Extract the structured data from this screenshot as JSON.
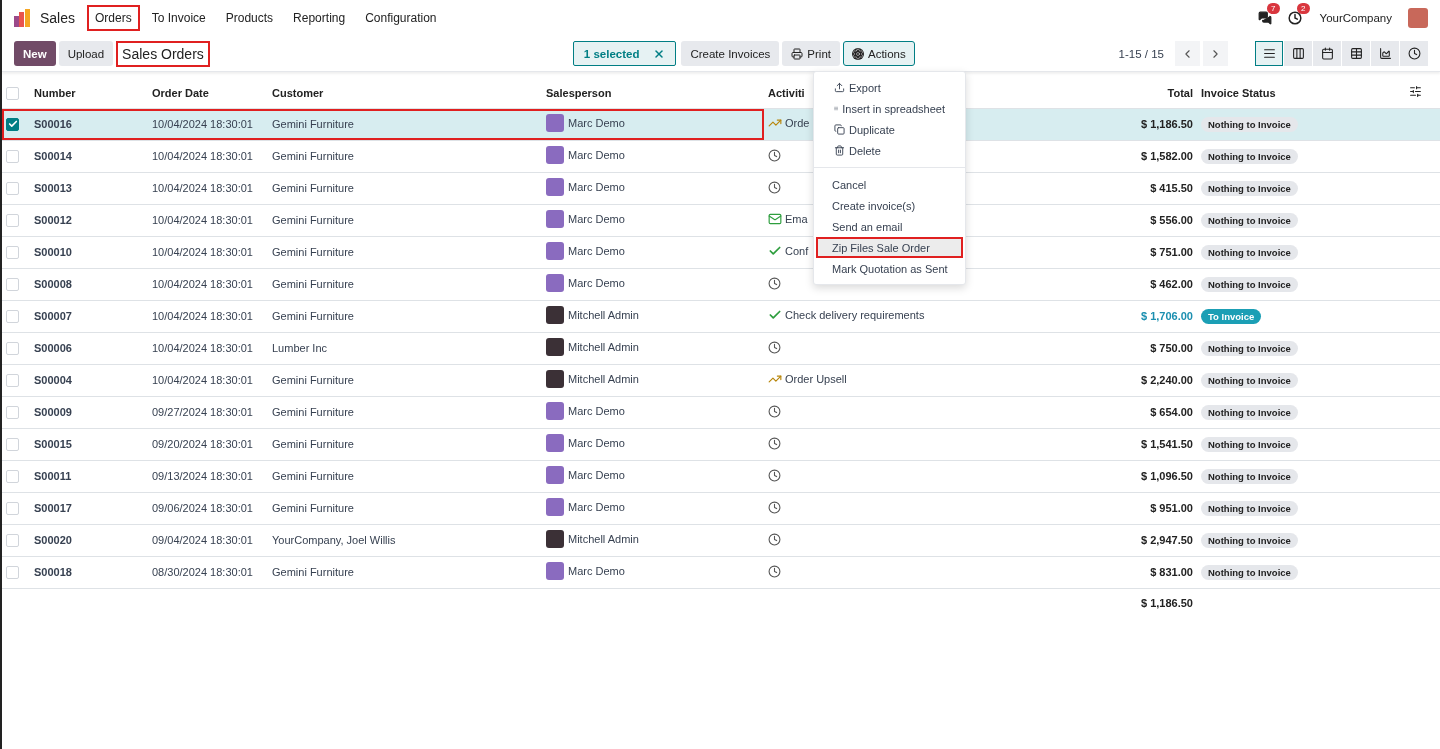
{
  "app": {
    "name": "Sales"
  },
  "menu": [
    {
      "label": "Orders",
      "highlighted": true
    },
    {
      "label": "To Invoice",
      "highlighted": false
    },
    {
      "label": "Products",
      "highlighted": false
    },
    {
      "label": "Reporting",
      "highlighted": false
    },
    {
      "label": "Configuration",
      "highlighted": false
    }
  ],
  "notifications": [
    {
      "kind": "messages",
      "count": "7"
    },
    {
      "kind": "activities",
      "count": "2"
    }
  ],
  "company": "YourCompany",
  "toolbar": {
    "buttons": [
      {
        "label": "New",
        "kind": "primary"
      },
      {
        "label": "Upload",
        "kind": "secondary"
      }
    ],
    "title": "Sales Orders",
    "title_highlighted": true,
    "selection": "1 selected",
    "actions": [
      {
        "label": "Create Invoices",
        "kind": "plain",
        "open": false
      },
      {
        "label": "Print",
        "kind": "print",
        "open": false
      },
      {
        "label": "Actions",
        "kind": "gear",
        "open": true
      }
    ],
    "pager": "1-15 / 15",
    "views": [
      {
        "kind": "list",
        "selected": true
      },
      {
        "kind": "kanban",
        "selected": false
      },
      {
        "kind": "calendar",
        "selected": false
      },
      {
        "kind": "pivot",
        "selected": false
      },
      {
        "kind": "graph",
        "selected": false
      },
      {
        "kind": "activity",
        "selected": false
      }
    ]
  },
  "table": {
    "all_selected": false,
    "columns": [
      "Number",
      "Order Date",
      "Customer",
      "Salesperson",
      "Activiti",
      "Total",
      "Invoice Status"
    ],
    "rows": [
      {
        "number": "S00016",
        "date": "10/04/2024 18:30:01",
        "customer": "Gemini Furniture",
        "salesperson": {
          "name": "Marc Demo",
          "color": "#8a6bbf"
        },
        "activity": {
          "kind": "upsell",
          "text": "Orde"
        },
        "total": "$ 1,186.50",
        "status": {
          "label": "Nothing to Invoice",
          "kind": "nothing"
        },
        "selected": true,
        "highlighted": true
      },
      {
        "number": "S00014",
        "date": "10/04/2024 18:30:01",
        "customer": "Gemini Furniture",
        "salesperson": {
          "name": "Marc Demo",
          "color": "#8a6bbf"
        },
        "activity": {
          "kind": "none"
        },
        "total": "$ 1,582.00",
        "status": {
          "label": "Nothing to Invoice",
          "kind": "nothing"
        },
        "selected": false,
        "highlighted": false
      },
      {
        "number": "S00013",
        "date": "10/04/2024 18:30:01",
        "customer": "Gemini Furniture",
        "salesperson": {
          "name": "Marc Demo",
          "color": "#8a6bbf"
        },
        "activity": {
          "kind": "none"
        },
        "total": "$ 415.50",
        "status": {
          "label": "Nothing to Invoice",
          "kind": "nothing"
        },
        "selected": false,
        "highlighted": false
      },
      {
        "number": "S00012",
        "date": "10/04/2024 18:30:01",
        "customer": "Gemini Furniture",
        "salesperson": {
          "name": "Marc Demo",
          "color": "#8a6bbf"
        },
        "activity": {
          "kind": "email",
          "text": "Ema"
        },
        "total": "$ 556.00",
        "status": {
          "label": "Nothing to Invoice",
          "kind": "nothing"
        },
        "selected": false,
        "highlighted": false
      },
      {
        "number": "S00010",
        "date": "10/04/2024 18:30:01",
        "customer": "Gemini Furniture",
        "salesperson": {
          "name": "Marc Demo",
          "color": "#8a6bbf"
        },
        "activity": {
          "kind": "todo",
          "text": "Conf"
        },
        "total": "$ 751.00",
        "status": {
          "label": "Nothing to Invoice",
          "kind": "nothing"
        },
        "selected": false,
        "highlighted": false
      },
      {
        "number": "S00008",
        "date": "10/04/2024 18:30:01",
        "customer": "Gemini Furniture",
        "salesperson": {
          "name": "Marc Demo",
          "color": "#8a6bbf"
        },
        "activity": {
          "kind": "none"
        },
        "total": "$ 462.00",
        "status": {
          "label": "Nothing to Invoice",
          "kind": "nothing"
        },
        "selected": false,
        "highlighted": false
      },
      {
        "number": "S00007",
        "date": "10/04/2024 18:30:01",
        "customer": "Gemini Furniture",
        "salesperson": {
          "name": "Mitchell Admin",
          "color": "#3b3036"
        },
        "activity": {
          "kind": "todo",
          "text": "Check delivery requirements"
        },
        "total": "$ 1,706.00",
        "status": {
          "label": "To Invoice",
          "kind": "to_invoice"
        },
        "selected": false,
        "highlighted": false
      },
      {
        "number": "S00006",
        "date": "10/04/2024 18:30:01",
        "customer": "Lumber Inc",
        "salesperson": {
          "name": "Mitchell Admin",
          "color": "#3b3036"
        },
        "activity": {
          "kind": "none"
        },
        "total": "$ 750.00",
        "status": {
          "label": "Nothing to Invoice",
          "kind": "nothing"
        },
        "selected": false,
        "highlighted": false
      },
      {
        "number": "S00004",
        "date": "10/04/2024 18:30:01",
        "customer": "Gemini Furniture",
        "salesperson": {
          "name": "Mitchell Admin",
          "color": "#3b3036"
        },
        "activity": {
          "kind": "upsell",
          "text": "Order Upsell"
        },
        "total": "$ 2,240.00",
        "status": {
          "label": "Nothing to Invoice",
          "kind": "nothing"
        },
        "selected": false,
        "highlighted": false
      },
      {
        "number": "S00009",
        "date": "09/27/2024 18:30:01",
        "customer": "Gemini Furniture",
        "salesperson": {
          "name": "Marc Demo",
          "color": "#8a6bbf"
        },
        "activity": {
          "kind": "none"
        },
        "total": "$ 654.00",
        "status": {
          "label": "Nothing to Invoice",
          "kind": "nothing"
        },
        "selected": false,
        "highlighted": false
      },
      {
        "number": "S00015",
        "date": "09/20/2024 18:30:01",
        "customer": "Gemini Furniture",
        "salesperson": {
          "name": "Marc Demo",
          "color": "#8a6bbf"
        },
        "activity": {
          "kind": "none"
        },
        "total": "$ 1,541.50",
        "status": {
          "label": "Nothing to Invoice",
          "kind": "nothing"
        },
        "selected": false,
        "highlighted": false
      },
      {
        "number": "S00011",
        "date": "09/13/2024 18:30:01",
        "customer": "Gemini Furniture",
        "salesperson": {
          "name": "Marc Demo",
          "color": "#8a6bbf"
        },
        "activity": {
          "kind": "none"
        },
        "total": "$ 1,096.50",
        "status": {
          "label": "Nothing to Invoice",
          "kind": "nothing"
        },
        "selected": false,
        "highlighted": false
      },
      {
        "number": "S00017",
        "date": "09/06/2024 18:30:01",
        "customer": "Gemini Furniture",
        "salesperson": {
          "name": "Marc Demo",
          "color": "#8a6bbf"
        },
        "activity": {
          "kind": "none"
        },
        "total": "$ 951.00",
        "status": {
          "label": "Nothing to Invoice",
          "kind": "nothing"
        },
        "selected": false,
        "highlighted": false
      },
      {
        "number": "S00020",
        "date": "09/04/2024 18:30:01",
        "customer": "YourCompany, Joel Willis",
        "salesperson": {
          "name": "Mitchell Admin",
          "color": "#3b3036"
        },
        "activity": {
          "kind": "none"
        },
        "total": "$ 2,947.50",
        "status": {
          "label": "Nothing to Invoice",
          "kind": "nothing"
        },
        "selected": false,
        "highlighted": false
      },
      {
        "number": "S00018",
        "date": "08/30/2024 18:30:01",
        "customer": "Gemini Furniture",
        "salesperson": {
          "name": "Marc Demo",
          "color": "#8a6bbf"
        },
        "activity": {
          "kind": "none"
        },
        "total": "$ 831.00",
        "status": {
          "label": "Nothing to Invoice",
          "kind": "nothing"
        },
        "selected": false,
        "highlighted": false
      }
    ],
    "footer_total": "$ 1,186.50"
  },
  "actions_menu": {
    "groups": [
      [
        {
          "label": "Export",
          "kind": "export",
          "highlighted": false
        },
        {
          "label": "Insert in spreadsheet",
          "kind": "spreadsheet",
          "highlighted": false
        },
        {
          "label": "Duplicate",
          "kind": "duplicate",
          "highlighted": false
        },
        {
          "label": "Delete",
          "kind": "delete",
          "highlighted": false
        }
      ],
      [
        {
          "label": "Cancel",
          "kind": "plain",
          "highlighted": false
        },
        {
          "label": "Create invoice(s)",
          "kind": "plain",
          "highlighted": false
        },
        {
          "label": "Send an email",
          "kind": "plain",
          "highlighted": false
        },
        {
          "label": "Zip Files Sale Order",
          "kind": "plain",
          "highlighted": true
        },
        {
          "label": "Mark Quotation as Sent",
          "kind": "plain",
          "highlighted": false
        }
      ]
    ]
  }
}
